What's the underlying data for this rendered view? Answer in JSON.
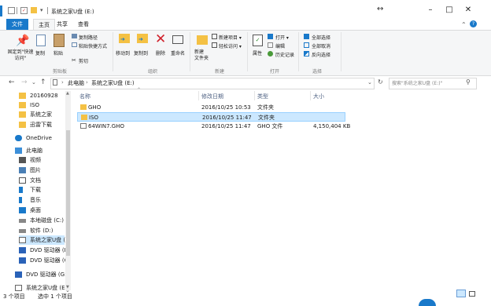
{
  "window": {
    "title": "系统之家U盘 (E:)",
    "controls": [
      "–",
      "□",
      "✕"
    ],
    "expand_glyph": "↔"
  },
  "tabs": [
    "文件",
    "主页",
    "共享",
    "查看"
  ],
  "ribbon": {
    "pin_label": "固定到\"快速访问\"",
    "copy_label": "复制",
    "paste_label": "粘贴",
    "copy_path_label": "复制路径",
    "paste_shortcut_label": "粘贴快捷方式",
    "cut_label": "剪切",
    "move_to_label": "移动到",
    "copy_to_label": "复制到",
    "delete_label": "删除",
    "rename_label": "重命名",
    "new_folder_label": "新建\n文件夹",
    "new_item_label": "新建项目 ▾",
    "easy_access_label": "轻松访问 ▾",
    "properties_label": "属性",
    "open_label": "打开 ▾",
    "edit_label": "编辑",
    "history_label": "历史记录",
    "select_all_label": "全部选择",
    "select_none_label": "全部取消",
    "invert_label": "反向选择",
    "groups": [
      "剪贴板",
      "组织",
      "新建",
      "打开",
      "选择"
    ]
  },
  "address": {
    "path": [
      "此电脑",
      "系统之家U盘 (E:)"
    ],
    "search_placeholder": "搜索\"系统之家U盘 (E:)\""
  },
  "nav": {
    "items": [
      {
        "label": "20160928",
        "icon": "folder-icon"
      },
      {
        "label": "ISO",
        "icon": "folder-icon"
      },
      {
        "label": "系统之家",
        "icon": "folder-icon"
      },
      {
        "label": "迅雷下载",
        "icon": "folder-icon"
      },
      {
        "label": "OneDrive",
        "icon": "cloud-icon"
      },
      {
        "label": "此电脑",
        "icon": "computer-icon"
      },
      {
        "label": "视频",
        "icon": "video-icon"
      },
      {
        "label": "图片",
        "icon": "picture-icon"
      },
      {
        "label": "文档",
        "icon": "document-icon"
      },
      {
        "label": "下载",
        "icon": "download-icon"
      },
      {
        "label": "音乐",
        "icon": "music-icon"
      },
      {
        "label": "桌面",
        "icon": "desktop-icon"
      },
      {
        "label": "本地磁盘 (C:)",
        "icon": "drive-icon"
      },
      {
        "label": "软件 (D:)",
        "icon": "drive-icon"
      },
      {
        "label": "系统之家U盘 (E:",
        "icon": "usb-drive-icon"
      },
      {
        "label": "DVD 驱动器 (F:)",
        "icon": "dvd-icon"
      },
      {
        "label": "DVD 驱动器 (G:",
        "icon": "dvd-icon"
      },
      {
        "label": "DVD 驱动器 (G:)",
        "icon": "dvd-icon"
      },
      {
        "label": "系统之家U盘 (E:)",
        "icon": "usb-drive-icon"
      }
    ]
  },
  "list": {
    "headers": [
      "名称",
      "修改日期",
      "类型",
      "大小"
    ],
    "rows": [
      {
        "name": "GHO",
        "date": "2016/10/25 10:53",
        "type": "文件夹",
        "size": ""
      },
      {
        "name": "ISO",
        "date": "2016/10/25 11:47",
        "type": "文件夹",
        "size": ""
      },
      {
        "name": "64WIN7.GHO",
        "date": "2016/10/25 11:47",
        "type": "GHO 文件",
        "size": "4,150,404 KB"
      }
    ]
  },
  "status": {
    "count": "3 个项目",
    "selected": "选中 1 个项目"
  },
  "colors": {
    "accent": "#1979ca",
    "folder": "#f4c144",
    "selection": "#cce8ff"
  }
}
